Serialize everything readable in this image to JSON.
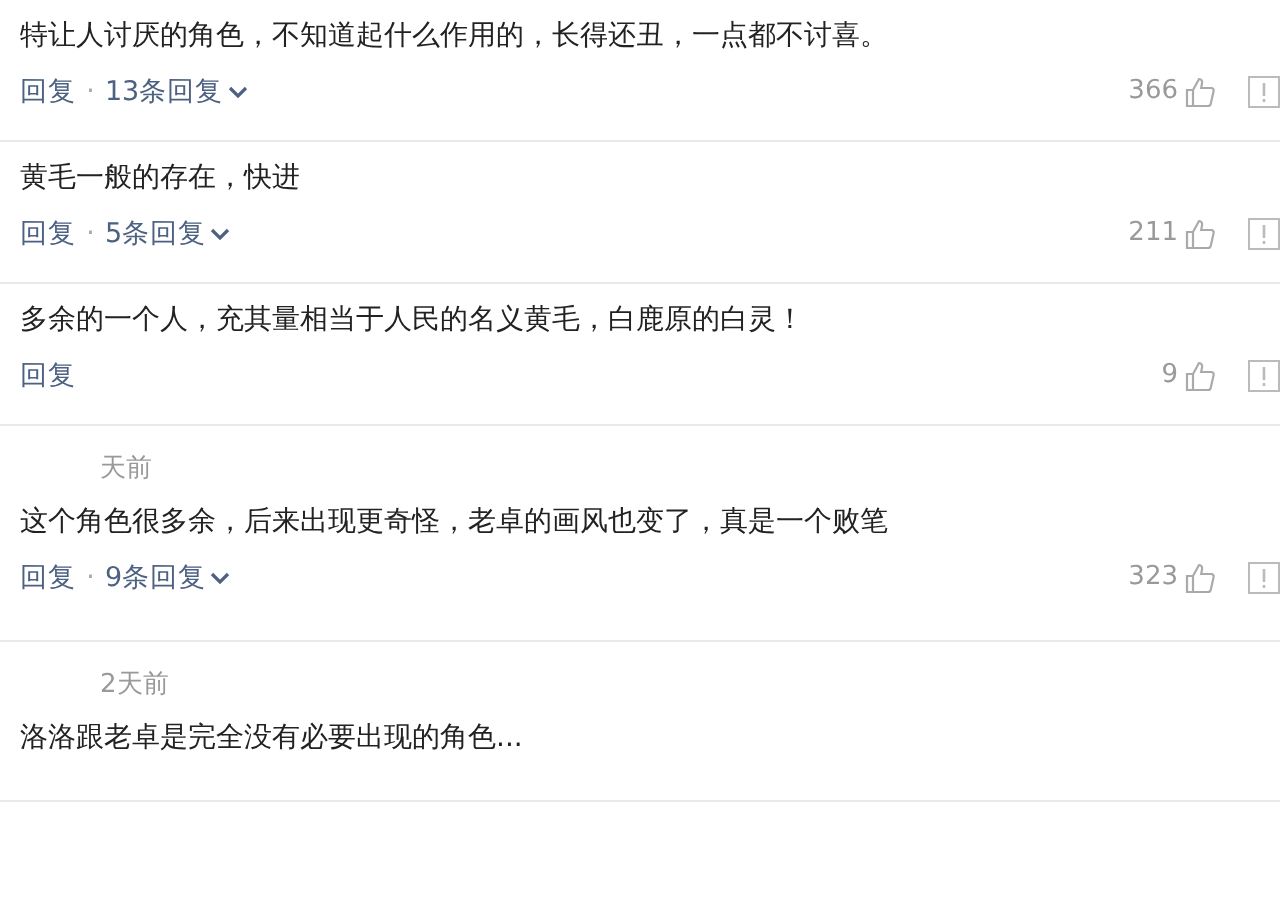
{
  "comments": [
    {
      "text": "特让人讨厌的角色，不知道起什么作用的，长得还丑，一点都不讨喜。",
      "reply": "回复",
      "separator": "·",
      "replies": "13条回复",
      "likes": "366"
    },
    {
      "text": "黄毛一般的存在，快进",
      "reply": "回复",
      "separator": "·",
      "replies": "5条回复",
      "likes": "211"
    },
    {
      "text": "多余的一个人，充其量相当于人民的名义黄毛，白鹿原的白灵！",
      "reply": "回复",
      "likes": "9"
    },
    {
      "meta": "天前",
      "text": "这个角色很多余，后来出现更奇怪，老卓的画风也变了，真是一个败笔",
      "reply": "回复",
      "separator": "·",
      "replies": "9条回复",
      "likes": "323"
    },
    {
      "meta": "2天前",
      "text": "洛洛跟老卓是完全没有必要出现的角色..."
    }
  ]
}
